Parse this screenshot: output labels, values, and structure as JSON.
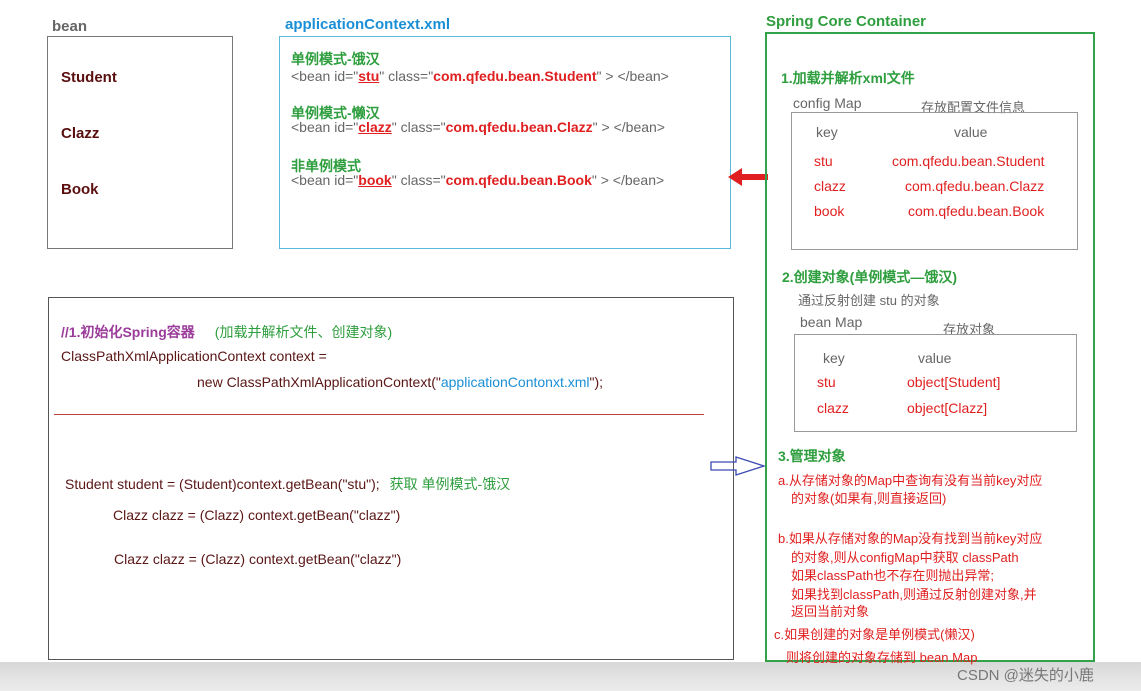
{
  "bean_panel": {
    "title": "bean",
    "classes": [
      "Student",
      "Clazz",
      "Book"
    ]
  },
  "xml_panel": {
    "title": "applicationContext.xml",
    "entries": [
      {
        "mode": "单例模式-饿汉",
        "prefix": "<bean id=\"",
        "id": "stu",
        "mid": "\" class=\"",
        "cls": "com.qfedu.bean.Student",
        "suffix": "\" > </bean>"
      },
      {
        "mode": "单例模式-懒汉",
        "prefix": "<bean id=\"",
        "id": "clazz",
        "mid": "\" class=\"",
        "cls": "com.qfedu.bean.Clazz",
        "suffix": "\" > </bean>"
      },
      {
        "mode": "非单例模式",
        "prefix": "<bean id=\"",
        "id": "book",
        "mid": "\" class=\"",
        "cls": "com.qfedu.bean.Book",
        "suffix": "\" > </bean>"
      }
    ]
  },
  "code_panel": {
    "comment": "//1.初始化Spring容器",
    "comment_note": "(加载并解析文件、创建对象)",
    "line1": "ClassPathXmlApplicationContext context =",
    "line2_prefix": "new ClassPathXmlApplicationContext(\"",
    "line2_file": "applicationContonxt.xml",
    "line2_suffix": "\");",
    "get1": "Student student = (Student)context.getBean(\"stu\");",
    "get1_note": "获取  单例模式-饿汉",
    "get2": "Clazz clazz = (Clazz)  context.getBean(\"clazz\")",
    "get3": "Clazz clazz = (Clazz)  context.getBean(\"clazz\")"
  },
  "container": {
    "title": "Spring Core Container",
    "step1": "1.加载并解析xml文件",
    "config_map_label": "config Map",
    "config_map_note": "存放配置文件信息",
    "config_headers": [
      "key",
      "value"
    ],
    "config_rows": [
      {
        "key": "stu",
        "value": "com.qfedu.bean.Student"
      },
      {
        "key": "clazz",
        "value": "com.qfedu.bean.Clazz"
      },
      {
        "key": "book",
        "value": "com.qfedu.bean.Book"
      }
    ],
    "step2": "2.创建对象(单例模式—饿汉)",
    "step2_note": "通过反射创建 stu 的对象",
    "bean_map_label": "bean Map",
    "bean_map_note": "存放对象",
    "bean_headers": [
      "key",
      "value"
    ],
    "bean_rows": [
      {
        "key": "stu",
        "value": "object[Student]"
      },
      {
        "key": "clazz",
        "value": "object[Clazz]"
      }
    ],
    "step3": "3.管理对象",
    "step3a_1": "a.从存储对象的Map中查询有没有当前key对应",
    "step3a_2": "的对象(如果有,则直接返回)",
    "step3b_1": "b.如果从存储对象的Map没有找到当前key对应",
    "step3b_2": "的对象,则从configMap中获取 classPath",
    "step3b_3": "如果classPath也不存在则抛出异常;",
    "step3b_4": "如果找到classPath,则通过反射创建对象,并",
    "step3b_5": "返回当前对象",
    "step3c_1": "c.如果创建的对象是单例模式(懒汉)",
    "step3c_2": "则将创建的对象存储到 bean Map"
  },
  "watermark": "CSDN @迷失的小鹿",
  "colors": {
    "green_border": "#33a34a",
    "xml_border": "#5ab8d8",
    "red": "#e02020",
    "arrow_blue": "#3a4ab0"
  }
}
